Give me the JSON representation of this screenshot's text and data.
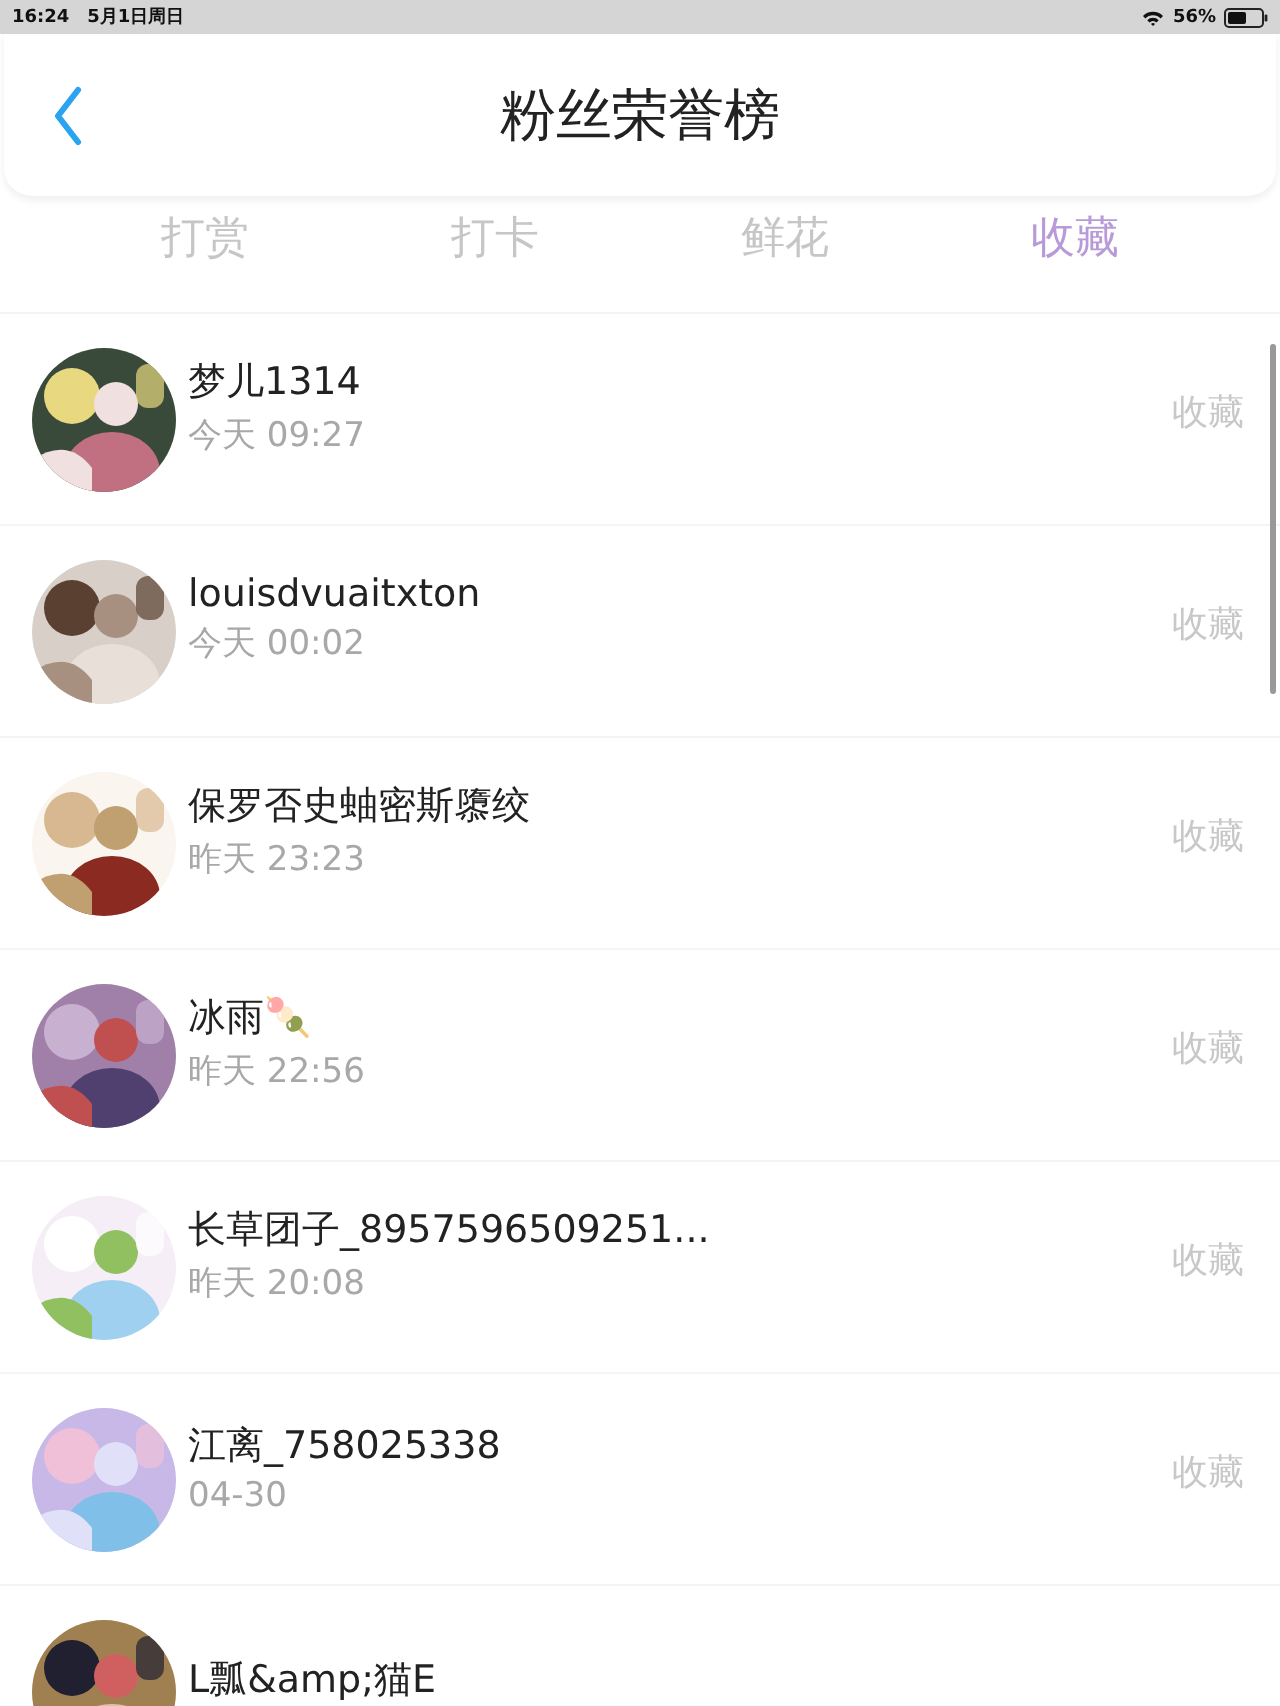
{
  "status_bar": {
    "time": "16:24",
    "date": "5月1日周日",
    "battery": "56%"
  },
  "header": {
    "title": "粉丝荣誉榜"
  },
  "tabs": [
    {
      "label": "打赏",
      "selected": false
    },
    {
      "label": "打卡",
      "selected": false
    },
    {
      "label": "鲜花",
      "selected": false
    },
    {
      "label": "收藏",
      "selected": true
    }
  ],
  "fans": [
    {
      "name": "梦儿1314",
      "time": "今天 09:27",
      "action": "收藏"
    },
    {
      "name": "louisdvuaitxton",
      "time": "今天 00:02",
      "action": "收藏"
    },
    {
      "name": "保罗否史蚰密斯隳绞",
      "time": "昨天 23:23",
      "action": "收藏"
    },
    {
      "name": "冰雨🍡",
      "time": "昨天 22:56",
      "action": "收藏"
    },
    {
      "name": "长草团子_8957596509251...",
      "time": "昨天 20:08",
      "action": "收藏"
    },
    {
      "name": "江离_758025338",
      "time": "04-30",
      "action": "收藏"
    },
    {
      "name": "L瓢&amp;猫E"
    }
  ]
}
